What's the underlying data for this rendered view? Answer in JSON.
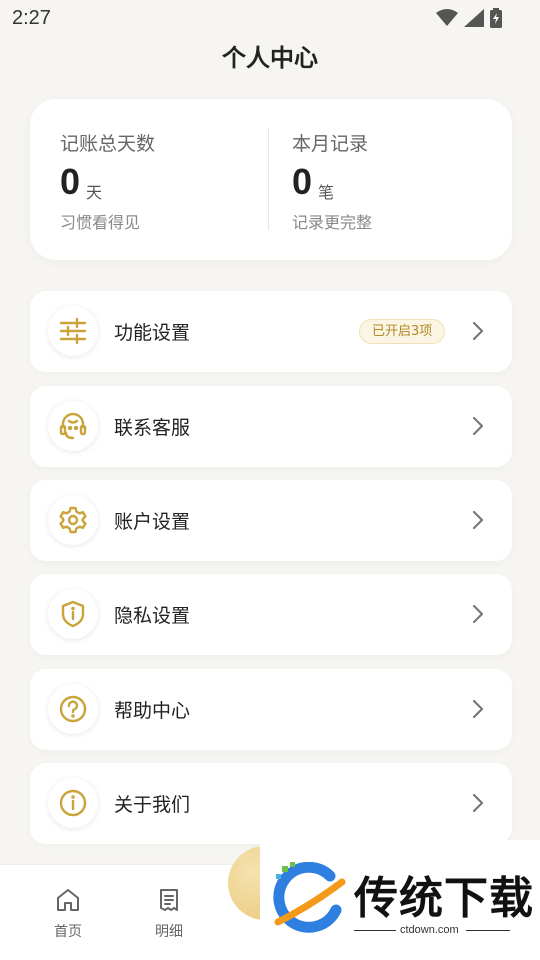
{
  "status_bar": {
    "time": "2:27"
  },
  "header": {
    "title": "个人中心"
  },
  "stats": {
    "left": {
      "label": "记账总天数",
      "value": "0",
      "unit": "天",
      "sub": "习惯看得见"
    },
    "right": {
      "label": "本月记录",
      "value": "0",
      "unit": "笔",
      "sub": "记录更完整"
    }
  },
  "menu": [
    {
      "label": "功能设置",
      "icon": "sliders-icon",
      "badge": "已开启3项"
    },
    {
      "label": "联系客服",
      "icon": "headset-icon"
    },
    {
      "label": "账户设置",
      "icon": "gear-icon"
    },
    {
      "label": "隐私设置",
      "icon": "shield-icon"
    },
    {
      "label": "帮助中心",
      "icon": "help-icon"
    },
    {
      "label": "关于我们",
      "icon": "info-icon"
    }
  ],
  "tab_bar": {
    "tabs": [
      {
        "label": "首页",
        "icon": "home-icon"
      },
      {
        "label": "明细",
        "icon": "receipt-icon"
      }
    ]
  },
  "watermark": {
    "text": "传统下载",
    "url": "ctdown.com"
  },
  "colors": {
    "accent": "#c9a43a",
    "background": "#f6f5f1",
    "card": "#ffffff"
  }
}
